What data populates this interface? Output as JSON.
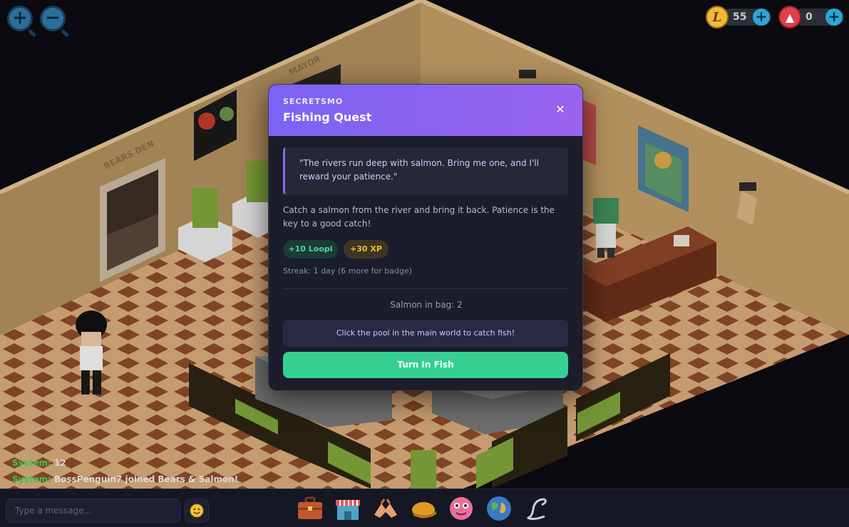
{
  "scene": {
    "sign_bears_den": "BEARS DEN",
    "sign_mayor": "MAYOR"
  },
  "zoom": {
    "zoom_in_icon": "zoom-in-icon",
    "zoom_out_icon": "zoom-out-icon"
  },
  "currency": {
    "loopi": {
      "value": "55",
      "icon": "loopi-coin-icon",
      "symbol": "L"
    },
    "gems": {
      "value": "0",
      "icon": "gem-coin-icon",
      "symbol": "▲"
    }
  },
  "quest_modal": {
    "npc_name": "SECRETSMO",
    "title": "Fishing Quest",
    "close_symbol": "✕",
    "quote": "\"The rivers run deep with salmon. Bring me one, and I'll reward your patience.\"",
    "description": "Catch a salmon from the river and bring it back. Patience is the key to a good catch!",
    "rewards": [
      "+10 Loopi",
      "+30 XP"
    ],
    "streak": "Streak: 1 day (6 more for badge)",
    "salmon_in_bag": "Salmon in bag: 2",
    "hint": "Click the pool in the main world to catch fish!",
    "turn_in_label": "Turn In Fish"
  },
  "chat": {
    "messages": [
      {
        "sender": "System:",
        "text": "12"
      },
      {
        "sender": "System:",
        "text": "BossPenguin7 joined Bears & Salmon!"
      }
    ],
    "input_placeholder": "Type a message...",
    "emoji_icon": "smiley-icon"
  },
  "toolbar": [
    "briefcase-icon",
    "shop-icon",
    "friends-hands-icon",
    "hat-icon",
    "pink-creature-icon",
    "globe-icon",
    "loopi-logo-icon"
  ],
  "colors": {
    "modal_header_start": "#7b63f2",
    "modal_header_end": "#9a63ee",
    "turn_in_button": "#35cf94",
    "loopi_reward": "#46d9a4",
    "xp_reward": "#f2b83a",
    "chat_system": "#38c84a"
  }
}
